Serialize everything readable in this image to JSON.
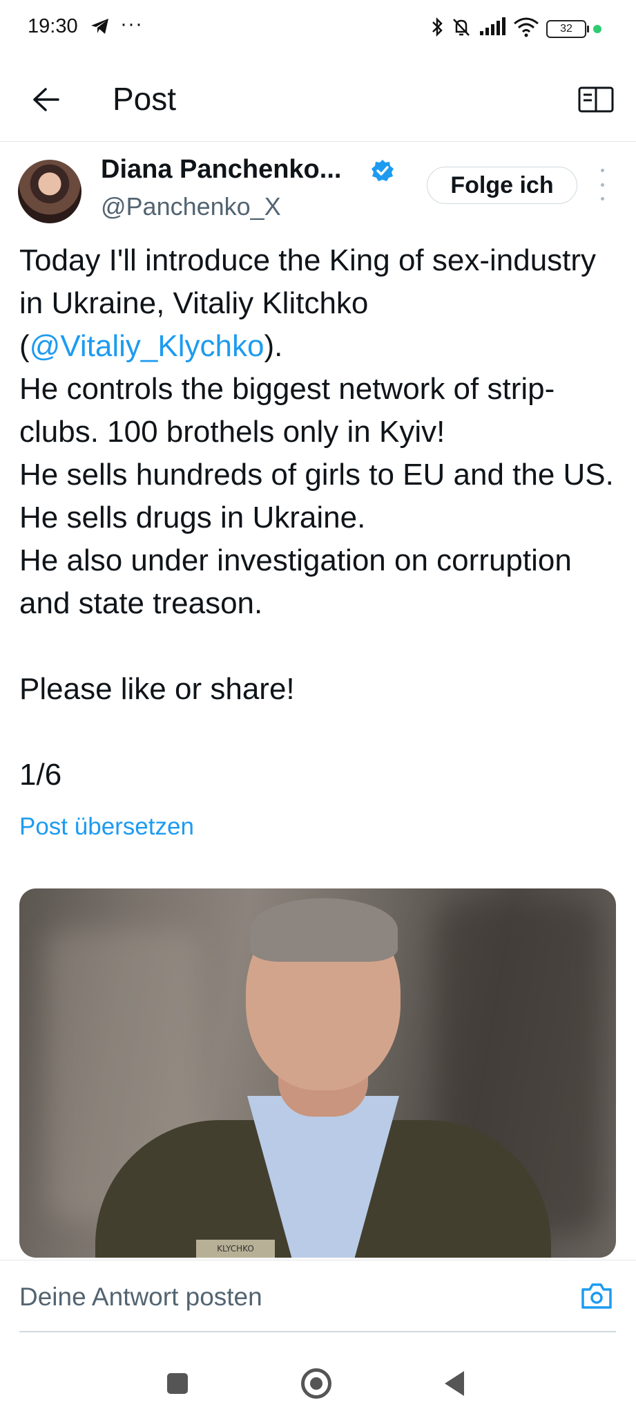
{
  "status_bar": {
    "time": "19:30",
    "overflow": "···",
    "battery_level": "32",
    "icons": [
      "telegram-icon",
      "bluetooth-icon",
      "mute-icon",
      "signal-icon",
      "wifi-icon",
      "battery-icon"
    ]
  },
  "header": {
    "title": "Post",
    "back_icon": "arrow-left-icon",
    "reader_icon": "book-open-icon"
  },
  "post": {
    "author": {
      "display_name": "Diana Panchenko...",
      "handle": "@Panchenko_X",
      "verified": true
    },
    "follow_label": "Folge ich",
    "text": {
      "line1_pre": "Today I'll introduce the King of sex-industry in Ukraine, Vitaliy Klitchko (",
      "mention": "@Vitaliy_Klychko",
      "line1_post": ").",
      "line2": "He controls the biggest network of strip-clubs. 100 brothels only in Kyiv!",
      "line3": "He sells hundreds of girls to EU and the US. He sells drugs in Ukraine.",
      "line4": "He also under investigation on corruption and state treason.",
      "line5": "Please like or share!",
      "line6": "1/6"
    },
    "translate_label": "Post übersetzen",
    "media_patch_text": "KLYCHKO"
  },
  "reply": {
    "placeholder": "Deine Antwort posten",
    "camera_icon": "camera-icon"
  },
  "colors": {
    "accent": "#1d9bf0",
    "text": "#0f1419",
    "secondary": "#536471"
  }
}
